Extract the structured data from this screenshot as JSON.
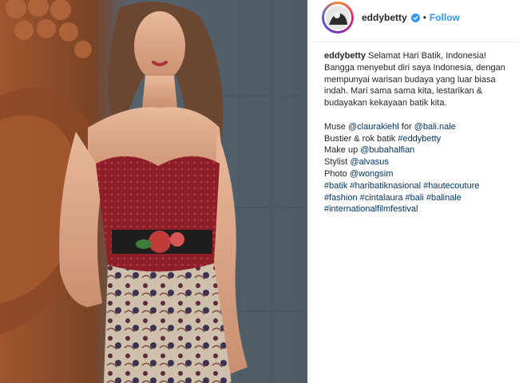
{
  "post": {
    "author": "eddybetty",
    "follow_label": "Follow",
    "separator": "•",
    "caption_text": "Selamat Hari Batik, Indonesia! Bangga menyebut diri saya Indonesia, dengan mempunyai warisan budaya yang luar biasa indah. Mari sama sama kita, lestarikan & budayakan kekayaan batik kita.",
    "credits": [
      {
        "prefix": "Muse ",
        "links": [
          "@claurakiehl"
        ],
        "middle": " for ",
        "links2": [
          "@bali.nale"
        ]
      },
      {
        "prefix": "Bustier & rok batik ",
        "links": [
          "#eddybetty"
        ]
      },
      {
        "prefix": "Make up ",
        "links": [
          "@bubahalfian"
        ]
      },
      {
        "prefix": "Stylist ",
        "links": [
          "@alvasus"
        ]
      },
      {
        "prefix": "Photo ",
        "links": [
          "@wongsim"
        ]
      }
    ],
    "hashtag_lines": [
      [
        "#batik",
        "#haribatiknasional",
        "#hautecouture"
      ],
      [
        "#fashion",
        "#cintalaura",
        "#bali",
        "#balinale"
      ],
      [
        "#internationalfilmfestival"
      ]
    ]
  },
  "colors": {
    "link": "#003569",
    "follow": "#3897f0",
    "verified": "#3897f0",
    "text": "#262626"
  },
  "icons": {
    "verified": "verified-badge-icon"
  }
}
